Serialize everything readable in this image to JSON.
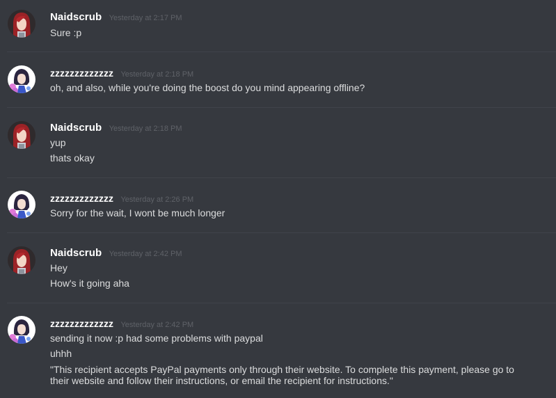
{
  "messages": [
    {
      "author": "Naidscrub",
      "avatar_icon": "red-hair-anime-avatar-icon",
      "timestamp": "Yesterday at 2:17 PM",
      "lines": [
        "Sure :p"
      ]
    },
    {
      "author": "zzzzzzzzzzzzz",
      "avatar_icon": "dark-hair-anime-avatar-icon",
      "timestamp": "Yesterday at 2:18 PM",
      "lines": [
        "oh, and also, while you're doing the boost do you mind appearing offline?"
      ]
    },
    {
      "author": "Naidscrub",
      "avatar_icon": "red-hair-anime-avatar-icon",
      "timestamp": "Yesterday at 2:18 PM",
      "lines": [
        "yup",
        "thats okay"
      ]
    },
    {
      "author": "zzzzzzzzzzzzz",
      "avatar_icon": "dark-hair-anime-avatar-icon",
      "timestamp": "Yesterday at 2:26 PM",
      "lines": [
        "Sorry for the wait, I wont be much longer"
      ]
    },
    {
      "author": "Naidscrub",
      "avatar_icon": "red-hair-anime-avatar-icon",
      "timestamp": "Yesterday at 2:42 PM",
      "lines": [
        "Hey",
        "How's it going aha"
      ]
    },
    {
      "author": "zzzzzzzzzzzzz",
      "avatar_icon": "dark-hair-anime-avatar-icon",
      "timestamp": "Yesterday at 2:42 PM",
      "lines": [
        "sending it now :p had some problems with paypal",
        "uhhh",
        "\"This recipient accepts PayPal payments only through their website. To complete this payment, please go to their website and follow their instructions, or email the recipient for instructions.\""
      ]
    }
  ],
  "colors": {
    "background": "#36393f",
    "username": "#ffffff",
    "timestamp": "#5f6268",
    "message_text": "#dcddde",
    "divider": "#40434a"
  }
}
